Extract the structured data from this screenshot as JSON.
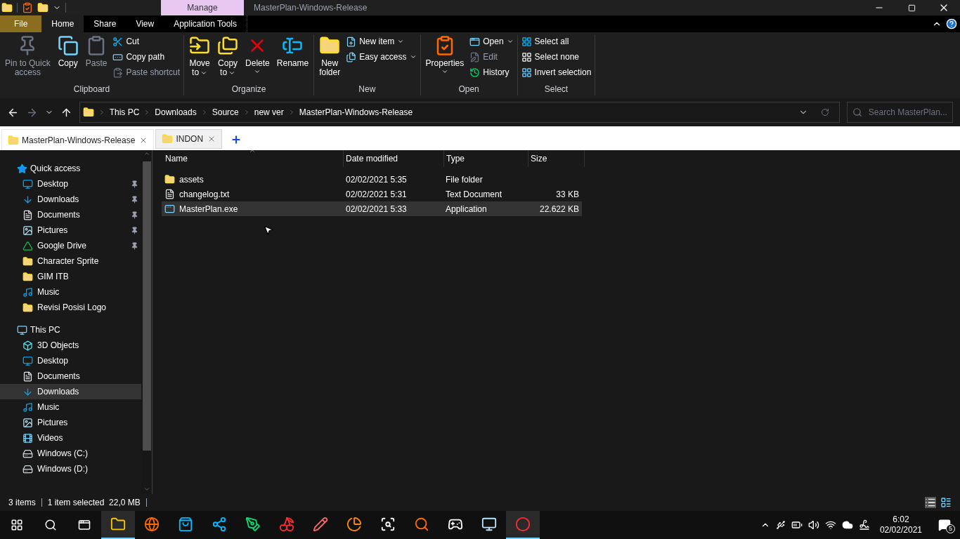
{
  "title_bar": {
    "context_tab": "Manage",
    "title": "MasterPlan-Windows-Release"
  },
  "ribbon_tabs": [
    {
      "label": "File",
      "kind": "file",
      "selected": false
    },
    {
      "label": "Home",
      "kind": "tab",
      "selected": true
    },
    {
      "label": "Share",
      "kind": "tab",
      "selected": false
    },
    {
      "label": "View",
      "kind": "tab",
      "selected": false
    },
    {
      "label": "Application Tools",
      "kind": "context",
      "selected": false
    }
  ],
  "ribbon_groups": [
    {
      "label": "Clipboard",
      "items": [
        {
          "kind": "large",
          "lines": [
            "Pin to Quick",
            "access"
          ],
          "disabled": true,
          "dropdown": false
        },
        {
          "kind": "large",
          "lines": [
            "Copy"
          ],
          "disabled": false,
          "dropdown": false
        },
        {
          "kind": "large",
          "lines": [
            "Paste"
          ],
          "disabled": true,
          "dropdown": false
        },
        {
          "kind": "stack",
          "items": [
            {
              "label": "Cut",
              "disabled": false,
              "dropdown": false
            },
            {
              "label": "Copy path",
              "disabled": false,
              "dropdown": false
            },
            {
              "label": "Paste shortcut",
              "disabled": true,
              "dropdown": false
            }
          ]
        }
      ]
    },
    {
      "label": "Organize",
      "items": [
        {
          "kind": "large",
          "lines": [
            "Move",
            "to"
          ],
          "disabled": false,
          "dropdown": true
        },
        {
          "kind": "large",
          "lines": [
            "Copy",
            "to"
          ],
          "disabled": false,
          "dropdown": true
        },
        {
          "kind": "large",
          "lines": [
            "Delete"
          ],
          "disabled": false,
          "dropdown": true
        },
        {
          "kind": "large",
          "lines": [
            "Rename"
          ],
          "disabled": false,
          "dropdown": false
        }
      ]
    },
    {
      "label": "New",
      "items": [
        {
          "kind": "large",
          "lines": [
            "New",
            "folder"
          ],
          "disabled": false,
          "dropdown": false
        },
        {
          "kind": "stack",
          "items": [
            {
              "label": "New item",
              "disabled": false,
              "dropdown": true
            },
            {
              "label": "Easy access",
              "disabled": false,
              "dropdown": true
            }
          ]
        }
      ]
    },
    {
      "label": "Open",
      "items": [
        {
          "kind": "large",
          "lines": [
            "Properties"
          ],
          "disabled": false,
          "dropdown": true
        },
        {
          "kind": "stack",
          "items": [
            {
              "label": "Open",
              "disabled": false,
              "dropdown": true
            },
            {
              "label": "Edit",
              "disabled": true,
              "dropdown": false
            },
            {
              "label": "History",
              "disabled": false,
              "dropdown": false
            }
          ]
        }
      ]
    },
    {
      "label": "Select",
      "items": [
        {
          "kind": "stack",
          "items": [
            {
              "label": "Select all",
              "disabled": false,
              "dropdown": false
            },
            {
              "label": "Select none",
              "disabled": false,
              "dropdown": false
            },
            {
              "label": "Invert selection",
              "disabled": false,
              "dropdown": false
            }
          ]
        }
      ]
    }
  ],
  "address_bar": {
    "crumbs": [
      "This PC",
      "Downloads",
      "Source",
      "new ver",
      "MasterPlan-Windows-Release"
    ],
    "search_placeholder": "Search MasterPlan..."
  },
  "folder_tabs": [
    {
      "label": "MasterPlan-Windows-Release",
      "selected": true
    },
    {
      "label": "INDON",
      "selected": false
    }
  ],
  "sidebar": [
    {
      "label": "Quick access",
      "selected": false,
      "children": [
        {
          "label": "Desktop",
          "pinned": true,
          "selected": false
        },
        {
          "label": "Downloads",
          "pinned": true,
          "selected": false
        },
        {
          "label": "Documents",
          "pinned": true,
          "selected": false
        },
        {
          "label": "Pictures",
          "pinned": true,
          "selected": false
        },
        {
          "label": "Google Drive",
          "pinned": true,
          "selected": false
        },
        {
          "label": "Character Sprite",
          "pinned": false,
          "selected": false
        },
        {
          "label": "GIM ITB",
          "pinned": false,
          "selected": false
        },
        {
          "label": "Music",
          "pinned": false,
          "selected": false
        },
        {
          "label": "Revisi Posisi Logo",
          "pinned": false,
          "selected": false
        }
      ]
    },
    {
      "label": "This PC",
      "selected": false,
      "children": [
        {
          "label": "3D Objects",
          "pinned": false,
          "selected": false
        },
        {
          "label": "Desktop",
          "pinned": false,
          "selected": false
        },
        {
          "label": "Documents",
          "pinned": false,
          "selected": false
        },
        {
          "label": "Downloads",
          "pinned": false,
          "selected": true
        },
        {
          "label": "Music",
          "pinned": false,
          "selected": false
        },
        {
          "label": "Pictures",
          "pinned": false,
          "selected": false
        },
        {
          "label": "Videos",
          "pinned": false,
          "selected": false
        },
        {
          "label": "Windows (C:)",
          "pinned": false,
          "selected": false
        },
        {
          "label": "Windows (D:)",
          "pinned": false,
          "selected": false
        }
      ]
    }
  ],
  "file_list": {
    "columns": [
      "Name",
      "Date modified",
      "Type",
      "Size"
    ],
    "rows": [
      {
        "kind": "folder",
        "name": "assets",
        "date": "02/02/2021 5:35",
        "type": "File folder",
        "selected": false
      },
      {
        "kind": "text",
        "name": "changelog.txt",
        "date": "02/02/2021 5:31",
        "type": "Text Document",
        "size": "33 KB",
        "selected": false
      },
      {
        "kind": "app",
        "name": "MasterPlan.exe",
        "date": "02/02/2021 5:33",
        "type": "Application",
        "size": "22.622 KB",
        "selected": true
      }
    ]
  },
  "status_bar": {
    "count": "3 items",
    "selection": "1 item selected  22,0 MB"
  },
  "taskbar": {
    "apps": [
      {
        "kind": "explorer",
        "running": true
      },
      {
        "kind": "browser",
        "running": false
      },
      {
        "kind": "store",
        "running": false
      },
      {
        "kind": "share",
        "running": false
      },
      {
        "kind": "pen",
        "running": false
      },
      {
        "kind": "berry",
        "running": false
      },
      {
        "kind": "pencil",
        "running": false
      },
      {
        "kind": "chart",
        "running": false
      },
      {
        "kind": "search",
        "running": false
      },
      {
        "kind": "magnifier",
        "running": false
      },
      {
        "kind": "xbox",
        "running": false
      },
      {
        "kind": "monitor",
        "running": false
      },
      {
        "kind": "record",
        "running": true
      }
    ],
    "time": "6:02",
    "date": "02/02/2021",
    "notifications": "5"
  }
}
